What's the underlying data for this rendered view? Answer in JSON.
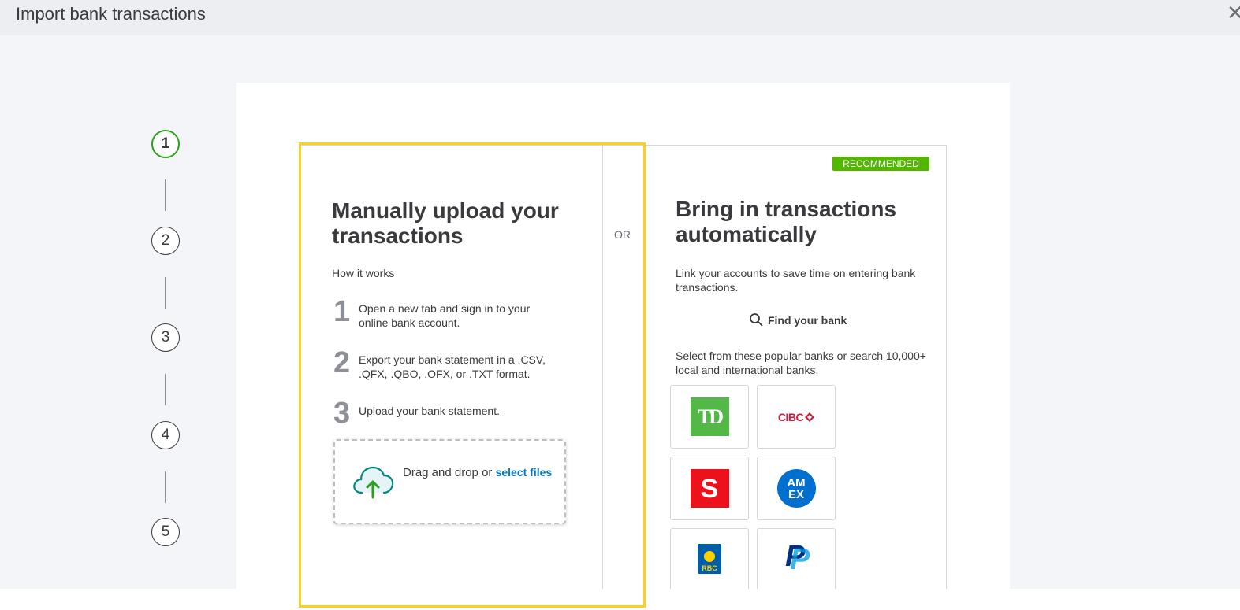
{
  "window": {
    "title": "Import bank transactions",
    "close_icon": "close-icon"
  },
  "stepper": {
    "steps": [
      "1",
      "2",
      "3",
      "4",
      "5"
    ],
    "active_step": "1",
    "active_color": "#2ca01c"
  },
  "left_panel": {
    "title": "Manually upload your transactions",
    "how_label": "How it works",
    "steps": [
      {
        "num": "1",
        "text": "Open a new tab and sign in to your online bank account."
      },
      {
        "num": "2",
        "text": "Export your bank statement in a .CSV, .QFX, .QBO, .OFX, or .TXT format."
      },
      {
        "num": "3",
        "text": "Upload your bank statement."
      }
    ],
    "dropzone": {
      "text": "Drag and drop or",
      "link": "select files",
      "icon": "cloud-upload-icon"
    }
  },
  "separator": "OR",
  "right_panel": {
    "badge": "RECOMMENDED",
    "badge_color": "#53b700",
    "title": "Bring in transactions automatically",
    "description": "Link your accounts to save time on entering bank transactions.",
    "find_bank": "Find your bank",
    "select_text": "Select from these popular banks or search 10,000+ local and international banks.",
    "banks": [
      {
        "name": "TD",
        "logo_text": "TD",
        "color": "#54b848"
      },
      {
        "name": "CIBC",
        "logo_text": "CIBC",
        "color": "#c41f3e"
      },
      {
        "name": "Scotiabank",
        "logo_text": "S",
        "color": "#ec111a"
      },
      {
        "name": "American Express",
        "logo_text": "AM EX",
        "color": "#016fd0"
      },
      {
        "name": "RBC",
        "logo_text": "RBC",
        "color": "#005daa"
      },
      {
        "name": "PayPal",
        "logo_text": "P",
        "color": "#003087"
      }
    ]
  },
  "accent_colors": {
    "link": "#0077c5",
    "highlight": "#ffd019"
  }
}
